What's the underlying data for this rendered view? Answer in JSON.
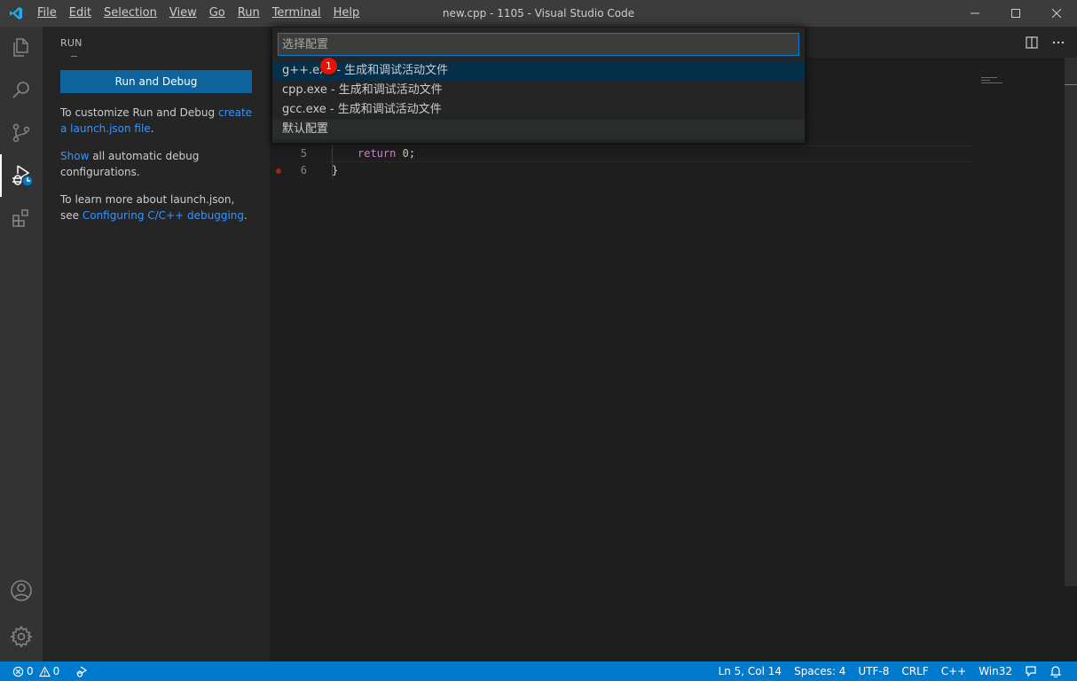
{
  "window": {
    "title": "new.cpp - 1105 - Visual Studio Code",
    "menu": [
      "File",
      "Edit",
      "Selection",
      "View",
      "Go",
      "Run",
      "Terminal",
      "Help"
    ],
    "menu_mnemonic_index": [
      0,
      0,
      0,
      0,
      0,
      0,
      0,
      0
    ]
  },
  "activity_bar": {
    "items": [
      "files-icon",
      "search-icon",
      "source-control-icon",
      "run-debug-icon",
      "extensions-icon"
    ],
    "active": "run-debug-icon",
    "bottom": [
      "accounts-icon",
      "manage-gear-icon"
    ]
  },
  "sidebar": {
    "title": "RUN",
    "run_button": "Run and Debug",
    "p1_text": "To customize Run and Debug ",
    "p1_link": "create a launch.json file",
    "p1_end": ".",
    "p2_link": "Show",
    "p2_text": " all automatic debug configurations.",
    "p3_text": "To learn more about launch.json, see ",
    "p3_link": "Configuring C/C++ debugging",
    "p3_end": "."
  },
  "editor": {
    "lines": [
      {
        "number": "5",
        "keyword": "return",
        "rest": " ",
        "value": "0",
        "end": ";"
      },
      {
        "number": "6",
        "text": "}"
      }
    ],
    "breakpoint_line": "6"
  },
  "quick_pick": {
    "placeholder": "选择配置",
    "value": "",
    "items": [
      "g++.exe - 生成和调试活动文件",
      "cpp.exe - 生成和调试活动文件",
      "gcc.exe - 生成和调试活动文件",
      "默认配置"
    ],
    "selected_index": 0,
    "badge": "1"
  },
  "status_bar": {
    "errors": "0",
    "warnings": "0",
    "position": "Ln 5, Col 14",
    "spaces": "Spaces: 4",
    "encoding": "UTF-8",
    "eol": "CRLF",
    "language": "C++",
    "platform": "Win32"
  },
  "colors": {
    "accent": "#007acc",
    "button": "#0e639c",
    "link": "#3794ff",
    "badge": "#e51400",
    "breakpoint": "#a1260d"
  }
}
